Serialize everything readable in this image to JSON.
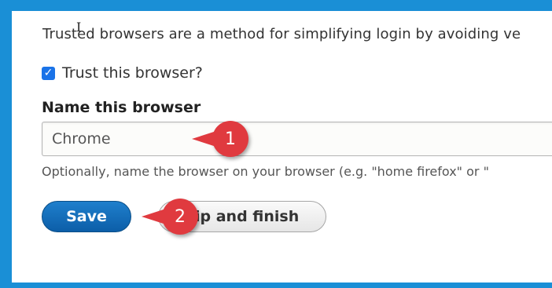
{
  "description": "Trusted browsers are a method for simplifying login by avoiding ve",
  "trust_checkbox": {
    "label": "Trust this browser?",
    "checked": true
  },
  "name_field": {
    "label": "Name this browser",
    "value": "Chrome",
    "help": "Optionally, name the browser on your browser (e.g. \"home firefox\" or \""
  },
  "buttons": {
    "save": "Save",
    "skip": "ip and finish"
  },
  "callouts": {
    "one": "1",
    "two": "2"
  },
  "colors": {
    "frame_border": "#1a8fd6",
    "save_button": "#0c5ea8",
    "callout": "#e03a3f",
    "checkbox": "#1a73e8"
  }
}
